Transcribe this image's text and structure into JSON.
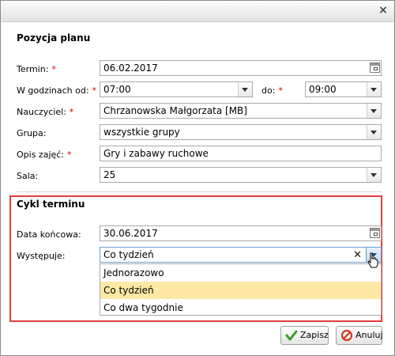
{
  "dialog": {
    "close_label": "×"
  },
  "plan": {
    "title": "Pozycja planu",
    "required_mark": "*",
    "termin": {
      "label": "Termin:",
      "value": "06.02.2017"
    },
    "godziny": {
      "label": "W godzinach od:",
      "from": "07:00",
      "to_label": "do:",
      "to": "09:00"
    },
    "nauczyciel": {
      "label": "Nauczyciel:",
      "value": "Chrzanowska Małgorzata [MB]"
    },
    "grupa": {
      "label": "Grupa:",
      "value": "wszystkie grupy"
    },
    "opis": {
      "label": "Opis zajęć:",
      "value": "Gry i zabawy ruchowe"
    },
    "sala": {
      "label": "Sala:",
      "value": "25"
    }
  },
  "cykl": {
    "title": "Cykl terminu",
    "data_koncowa": {
      "label": "Data końcowa:",
      "value": "30.06.2017"
    },
    "wystepuje": {
      "label": "Występuje:",
      "value": "Co tydzień",
      "clear": "✕",
      "options": [
        "Jednorazowo",
        "Co tydzień",
        "Co dwa tygodnie"
      ],
      "selected_index": 1
    }
  },
  "buttons": {
    "save": "Zapisz",
    "cancel": "Anuluj"
  },
  "colors": {
    "highlight_border": "#e03c3c",
    "selected_option": "#fde8a6"
  }
}
